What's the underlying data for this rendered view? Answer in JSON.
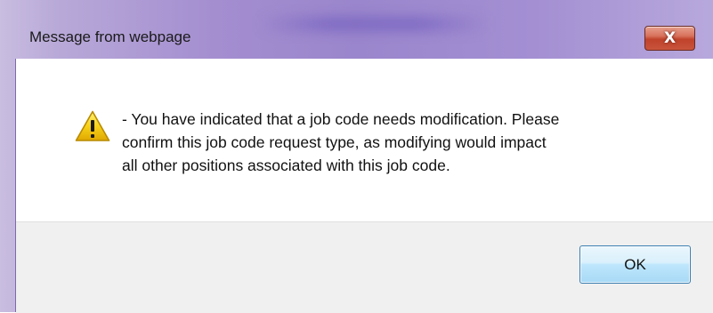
{
  "window": {
    "title": "Message from webpage",
    "close_glyph": "X"
  },
  "dialog": {
    "icon": "warning-icon",
    "message_lines": [
      "- You have indicated that a job code needs modification. Please",
      "confirm this job code request type, as modifying would impact",
      "all other positions associated with this job code."
    ],
    "ok_label": "OK"
  },
  "colors": {
    "titlebar": "#a48ed0",
    "close_button": "#c9543c",
    "ok_button_border": "#3c7fb1",
    "warning_yellow": "#f5c400"
  }
}
